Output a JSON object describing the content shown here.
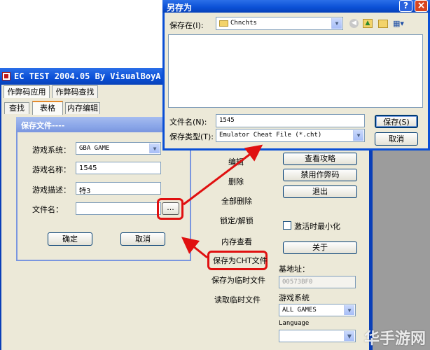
{
  "main_window": {
    "title": "EC TEST 2004.05  By VisualBoyA",
    "title_icon": "app-icon",
    "top_tabs": [
      "作弊码应用",
      "作弊码查找"
    ],
    "sub_tabs": [
      "查找",
      "表格",
      "内存编辑"
    ]
  },
  "middle_buttons": [
    "编辑",
    "删除",
    "全部删除",
    "锁定/解锁",
    "内存查看",
    "保存为CHT文件",
    "保存为临时文件",
    "读取临时文件"
  ],
  "right_panel": {
    "buttons": [
      "查看攻略",
      "禁用作弊码",
      "退出"
    ],
    "minimize_checkbox_label": "激活时最小化",
    "about_button": "关于",
    "base_address_label": "基地址：",
    "base_address_value": "00573BF0",
    "system_label": "游戏系统",
    "system_value": "ALL GAMES",
    "language_label": "Language"
  },
  "save_dialog": {
    "title": "保存文件----",
    "fields": [
      {
        "label": "游戏系统：",
        "value": "GBA GAME"
      },
      {
        "label": "游戏名称：",
        "value": "1545"
      },
      {
        "label": "游戏描述：",
        "value": "特3"
      },
      {
        "label": "文件名：",
        "value": ""
      }
    ],
    "browse_button": "...",
    "ok_button": "确定",
    "cancel_button": "取消"
  },
  "save_as_dialog": {
    "title": "另存为",
    "save_in_label": "保存在(I):",
    "folder": "Chnchts",
    "filename_label": "文件名(N):",
    "filename_value": "1545",
    "filetype_label": "保存类型(T):",
    "filetype_value": "Emulator Cheat File (*.cht)",
    "save_button": "保存(S)",
    "cancel_button": "取消",
    "help_button": "?",
    "close_button": "×",
    "toolbar_icons": [
      "back-icon",
      "up-folder-icon",
      "new-folder-icon",
      "view-menu-icon"
    ]
  },
  "watermark": "华手游网",
  "colors": {
    "xp_title_blue": "#0a54e3",
    "inactive_title": "#7a96df",
    "highlight_red": "#e01010",
    "arrow_red": "#e01010",
    "dialog_face": "#ece9d8"
  }
}
